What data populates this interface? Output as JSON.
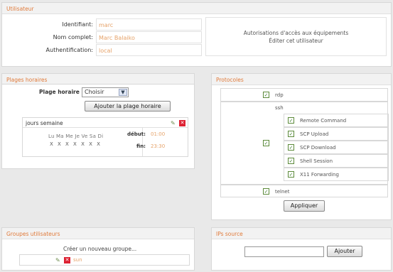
{
  "user": {
    "title": "Utilisateur",
    "fields": [
      {
        "label": "Identifiant:",
        "value": "marc"
      },
      {
        "label": "Nom complet:",
        "value": "Marc Balaiko"
      },
      {
        "label": "Authentification:",
        "value": "local"
      }
    ],
    "links": [
      "Autorisations d'accès aux équipements",
      "Éditer cet utilisateur"
    ]
  },
  "plages": {
    "title": "Plages horaires",
    "select_label": "Plage horaire :",
    "select_value": "Choisir",
    "add_button": "Ajouter la plage horaire",
    "slot": {
      "name": "jours semaine",
      "days": "Lu Ma Me Je Ve Sa Di",
      "marks": "X X X X X X X",
      "start_label": "début:",
      "start_value": "01:00",
      "end_label": "fin:",
      "end_value": "23:30"
    }
  },
  "protocols": {
    "title": "Protocoles",
    "items": [
      {
        "name": "rdp",
        "checked": true
      },
      {
        "name": "ssh",
        "checked": true,
        "sub": [
          {
            "name": "Remote Command",
            "checked": true
          },
          {
            "name": "SCP Upload",
            "checked": true
          },
          {
            "name": "SCP Download",
            "checked": true
          },
          {
            "name": "Shell Session",
            "checked": true
          },
          {
            "name": "X11 Forwarding",
            "checked": true
          }
        ]
      },
      {
        "name": "telnet",
        "checked": true
      }
    ],
    "apply_button": "Appliquer"
  },
  "groups": {
    "title": "Groupes utilisateurs",
    "create_link": "Créer un nouveau groupe...",
    "members": [
      "sun"
    ]
  },
  "ips": {
    "title": "IPs source",
    "input_value": "",
    "add_button": "Ajouter"
  }
}
